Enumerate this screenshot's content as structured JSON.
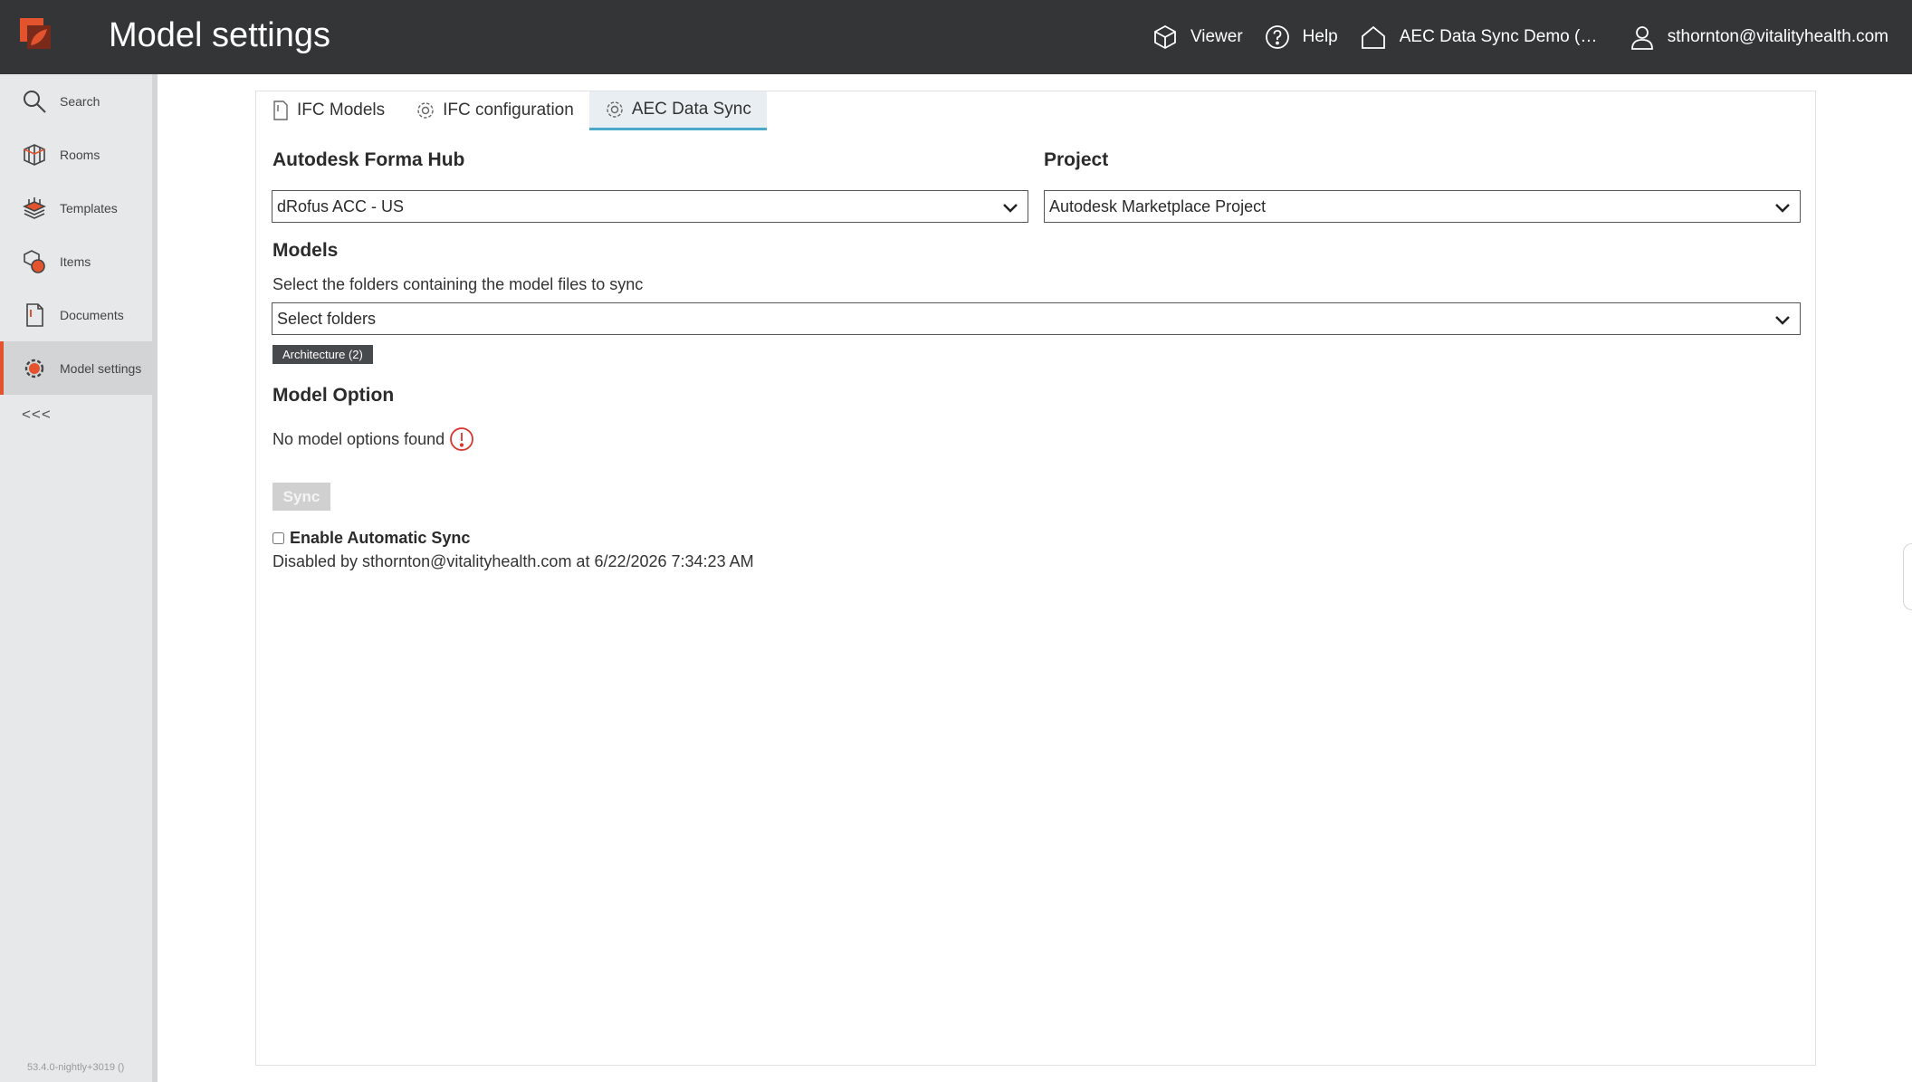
{
  "header": {
    "title": "Model settings",
    "viewer_label": "Viewer",
    "help_label": "Help",
    "project_label": "AEC Data Sync Demo (Err...",
    "user_label": "sthornton@vitalityhealth.com",
    "logo_icon": "drofus-logo-icon"
  },
  "sidebar": {
    "items": [
      {
        "label": "Search",
        "icon": "search-icon"
      },
      {
        "label": "Rooms",
        "icon": "rooms-icon"
      },
      {
        "label": "Templates",
        "icon": "templates-icon"
      },
      {
        "label": "Items",
        "icon": "items-icon"
      },
      {
        "label": "Documents",
        "icon": "documents-icon"
      },
      {
        "label": "Model settings",
        "icon": "gear-icon",
        "active": true
      }
    ],
    "collapse_label": "<<<",
    "version": "53.4.0-nightly+3019 ()"
  },
  "tabs": [
    {
      "label": "IFC Models",
      "icon": "document-icon"
    },
    {
      "label": "IFC configuration",
      "icon": "gear-icon"
    },
    {
      "label": "AEC Data Sync",
      "icon": "gear-icon",
      "active": true
    }
  ],
  "form": {
    "hub_heading": "Autodesk Forma Hub",
    "hub_value": "dRofus ACC - US",
    "project_heading": "Project",
    "project_value": "Autodesk Marketplace Project",
    "models_heading": "Models",
    "models_help": "Select the folders containing the model files to sync",
    "folders_placeholder": "Select folders",
    "selected_tag": "Architecture (2)",
    "model_option_heading": "Model Option",
    "no_options_text": "No model options found",
    "sync_label": "Sync",
    "auto_sync_label": "Enable Automatic Sync",
    "auto_sync_checked": false,
    "disabled_text": "Disabled by sthornton@vitalityhealth.com at 6/22/2026 7:34:23 AM"
  },
  "colors": {
    "topbar": "#333537",
    "accent": "#e3532d",
    "tab_active_underline": "#4aa9c8",
    "warning": "#d9342b"
  }
}
